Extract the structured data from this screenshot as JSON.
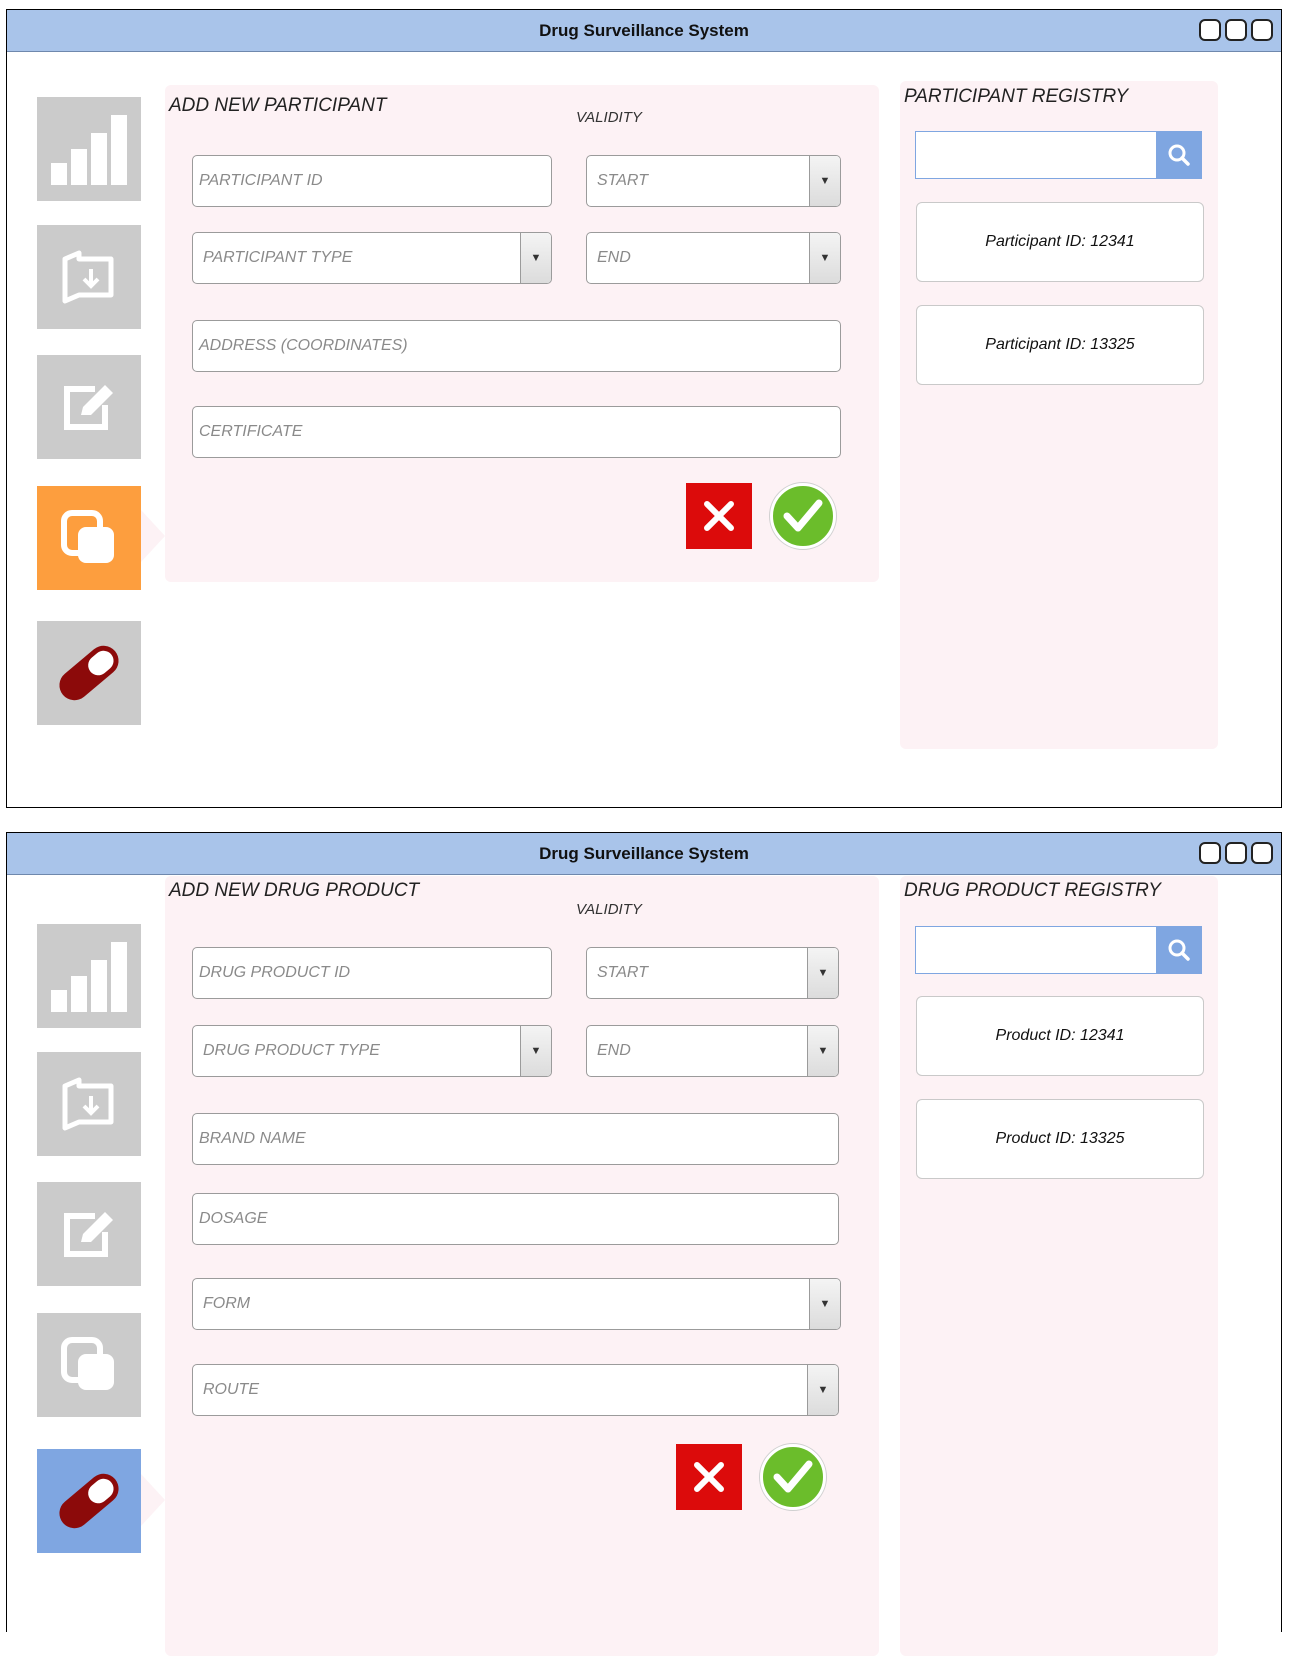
{
  "screens": [
    {
      "title": "Drug Surveillance System",
      "form_title": "ADD NEW PARTICIPANT",
      "validity_label": "VALIDITY",
      "fields": {
        "id": "PARTICIPANT ID",
        "start": "START",
        "type": "PARTICIPANT TYPE",
        "end": "END",
        "address": "ADDRESS (COORDINATES)",
        "certificate": "CERTIFICATE"
      },
      "registry_title": "PARTICIPANT REGISTRY",
      "search_value": "",
      "registry_items": [
        "Participant ID: 12341",
        "Participant ID: 13325"
      ],
      "active_nav": "participants"
    },
    {
      "title": "Drug Surveillance System",
      "form_title": "ADD NEW DRUG PRODUCT",
      "validity_label": "VALIDITY",
      "fields": {
        "id": "DRUG PRODUCT ID",
        "start": "START",
        "type": "DRUG PRODUCT TYPE",
        "end": "END",
        "brand": "BRAND NAME",
        "dosage": "DOSAGE",
        "form": "FORM",
        "route": "ROUTE"
      },
      "registry_title": "DRUG PRODUCT REGISTRY",
      "search_value": "",
      "registry_items": [
        "Product ID: 12341",
        "Product ID: 13325"
      ],
      "active_nav": "drug-products"
    }
  ],
  "nav_icons": [
    "bar-chart-icon",
    "folder-import-icon",
    "edit-icon",
    "copy-icon",
    "pill-icon"
  ],
  "colors": {
    "titlebar": "#a9c4ea",
    "panel": "#fdf2f5",
    "active_orange": "#fd9e3e",
    "active_blue": "#7fa6e1",
    "cancel": "#dc0b0b",
    "confirm": "#6bbd2b"
  }
}
